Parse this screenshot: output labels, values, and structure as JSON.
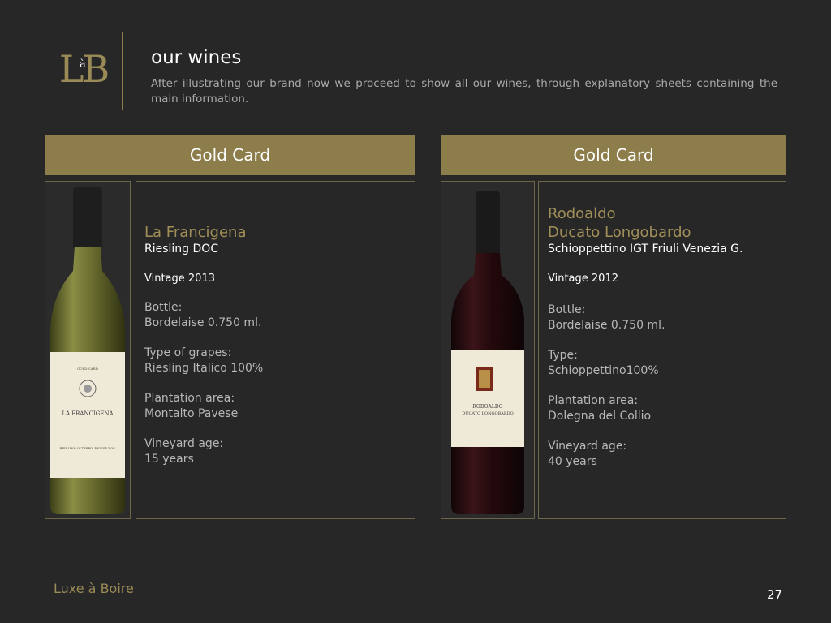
{
  "logo": {
    "big": "LB",
    "small": "à"
  },
  "header": {
    "title": "our wines",
    "intro": "After illustrating our brand now we proceed to show all our wines, through explanatory sheets containing the main information."
  },
  "cards": [
    {
      "header": "Gold Card",
      "name_lines": [
        "La Francigena"
      ],
      "appellation": "Riesling DOC",
      "vintage": "Vintage 2013",
      "bottle_label": "Bottle:",
      "bottle_value": "Bordelaise 0.750 ml.",
      "grapes_label": "Type of grapes:",
      "grapes_value": "Riesling Italico 100%",
      "area_label": "Plantation area:",
      "area_value": "Montalto Pavese",
      "age_label": "Vineyard age:",
      "age_value": "15 years",
      "bottle_image": {
        "label_top": "GOLD CARD",
        "label_name": "LA FRANCIGENA",
        "label_bottom": "RIESLING OLTREPO' PAVESE DOC"
      }
    },
    {
      "header": "Gold Card",
      "name_lines": [
        "Rodoaldo",
        "Ducato Longobardo"
      ],
      "appellation": "Schioppettino IGT Friuli Venezia G.",
      "vintage": "Vintage 2012",
      "bottle_label": "Bottle:",
      "bottle_value": "Bordelaise 0.750 ml.",
      "grapes_label": "Type:",
      "grapes_value": "Schioppettino100%",
      "area_label": "Plantation area:",
      "area_value": "Dolegna del Collio",
      "age_label": "Vineyard age:",
      "age_value": "40 years",
      "bottle_image": {
        "label_name": "RODOALDO",
        "label_sub": "DUCATO LONGOBARDO"
      }
    }
  ],
  "footer": {
    "brand": "Luxe à Boire",
    "page": "27"
  },
  "colors": {
    "background": "#272727",
    "gold": "#8c7d4b",
    "gold_text": "#a08e58"
  }
}
